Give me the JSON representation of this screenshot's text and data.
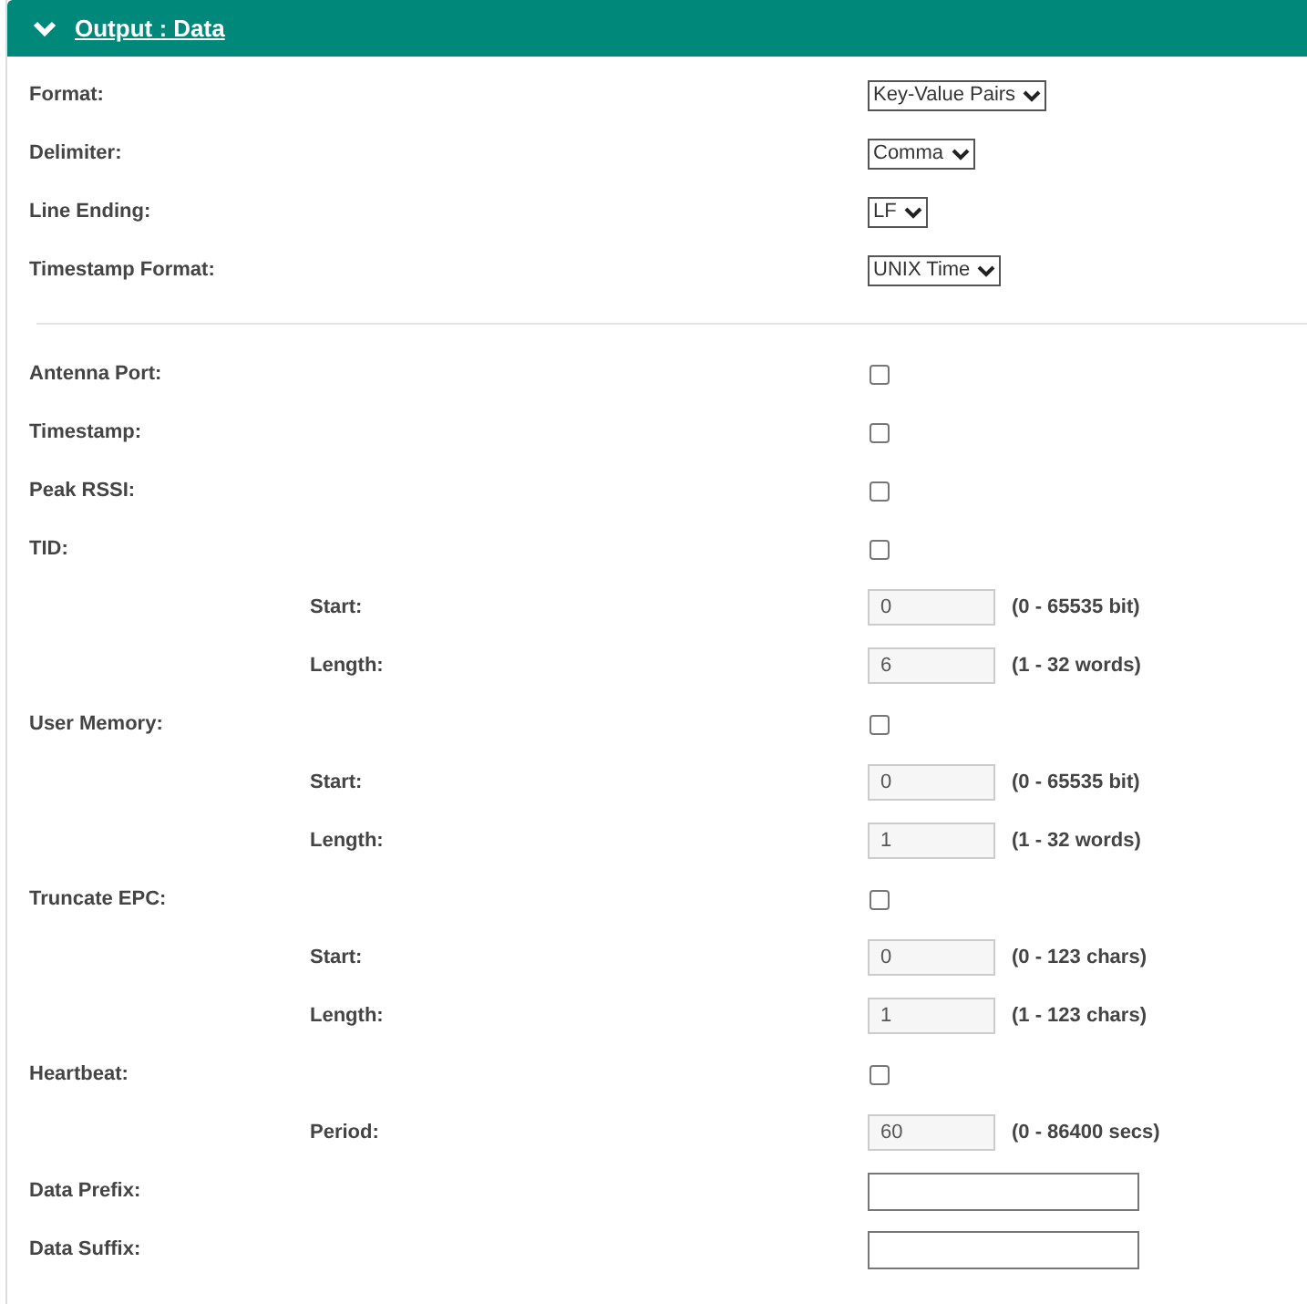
{
  "panel": {
    "title": "Output : Data",
    "expanded": true
  },
  "format_rows": [
    {
      "label": "Format:",
      "kind": "select",
      "value": "Key-Value Pairs"
    },
    {
      "label": "Delimiter:",
      "kind": "select",
      "value": "Comma"
    },
    {
      "label": "Line Ending:",
      "kind": "select",
      "value": "LF"
    },
    {
      "label": "Timestamp Format:",
      "kind": "select",
      "value": "UNIX Time"
    }
  ],
  "option_rows": [
    {
      "label": "Antenna Port:",
      "kind": "checkbox",
      "checked": false
    },
    {
      "label": "Timestamp:",
      "kind": "checkbox",
      "checked": false
    },
    {
      "label": "Peak RSSI:",
      "kind": "checkbox",
      "checked": false
    },
    {
      "label": "TID:",
      "kind": "checkbox",
      "checked": false,
      "children": [
        {
          "label": "Start:",
          "kind": "number",
          "value": "0",
          "disabled": true,
          "hint": "(0 - 65535 bit)"
        },
        {
          "label": "Length:",
          "kind": "number",
          "value": "6",
          "disabled": true,
          "hint": "(1 - 32 words)"
        }
      ]
    },
    {
      "label": "User Memory:",
      "kind": "checkbox",
      "checked": false,
      "children": [
        {
          "label": "Start:",
          "kind": "number",
          "value": "0",
          "disabled": true,
          "hint": "(0 - 65535 bit)"
        },
        {
          "label": "Length:",
          "kind": "number",
          "value": "1",
          "disabled": true,
          "hint": "(1 - 32 words)"
        }
      ]
    },
    {
      "label": "Truncate EPC:",
      "kind": "checkbox",
      "checked": false,
      "children": [
        {
          "label": "Start:",
          "kind": "number",
          "value": "0",
          "disabled": true,
          "hint": "(0 - 123 chars)"
        },
        {
          "label": "Length:",
          "kind": "number",
          "value": "1",
          "disabled": true,
          "hint": "(1 - 123 chars)"
        }
      ]
    },
    {
      "label": "Heartbeat:",
      "kind": "checkbox",
      "checked": false,
      "children": [
        {
          "label": "Period:",
          "kind": "number",
          "value": "60",
          "disabled": true,
          "hint": "(0 - 86400 secs)"
        }
      ]
    },
    {
      "label": "Data Prefix:",
      "kind": "text"
    },
    {
      "label": "Data Suffix:",
      "kind": "text"
    }
  ]
}
